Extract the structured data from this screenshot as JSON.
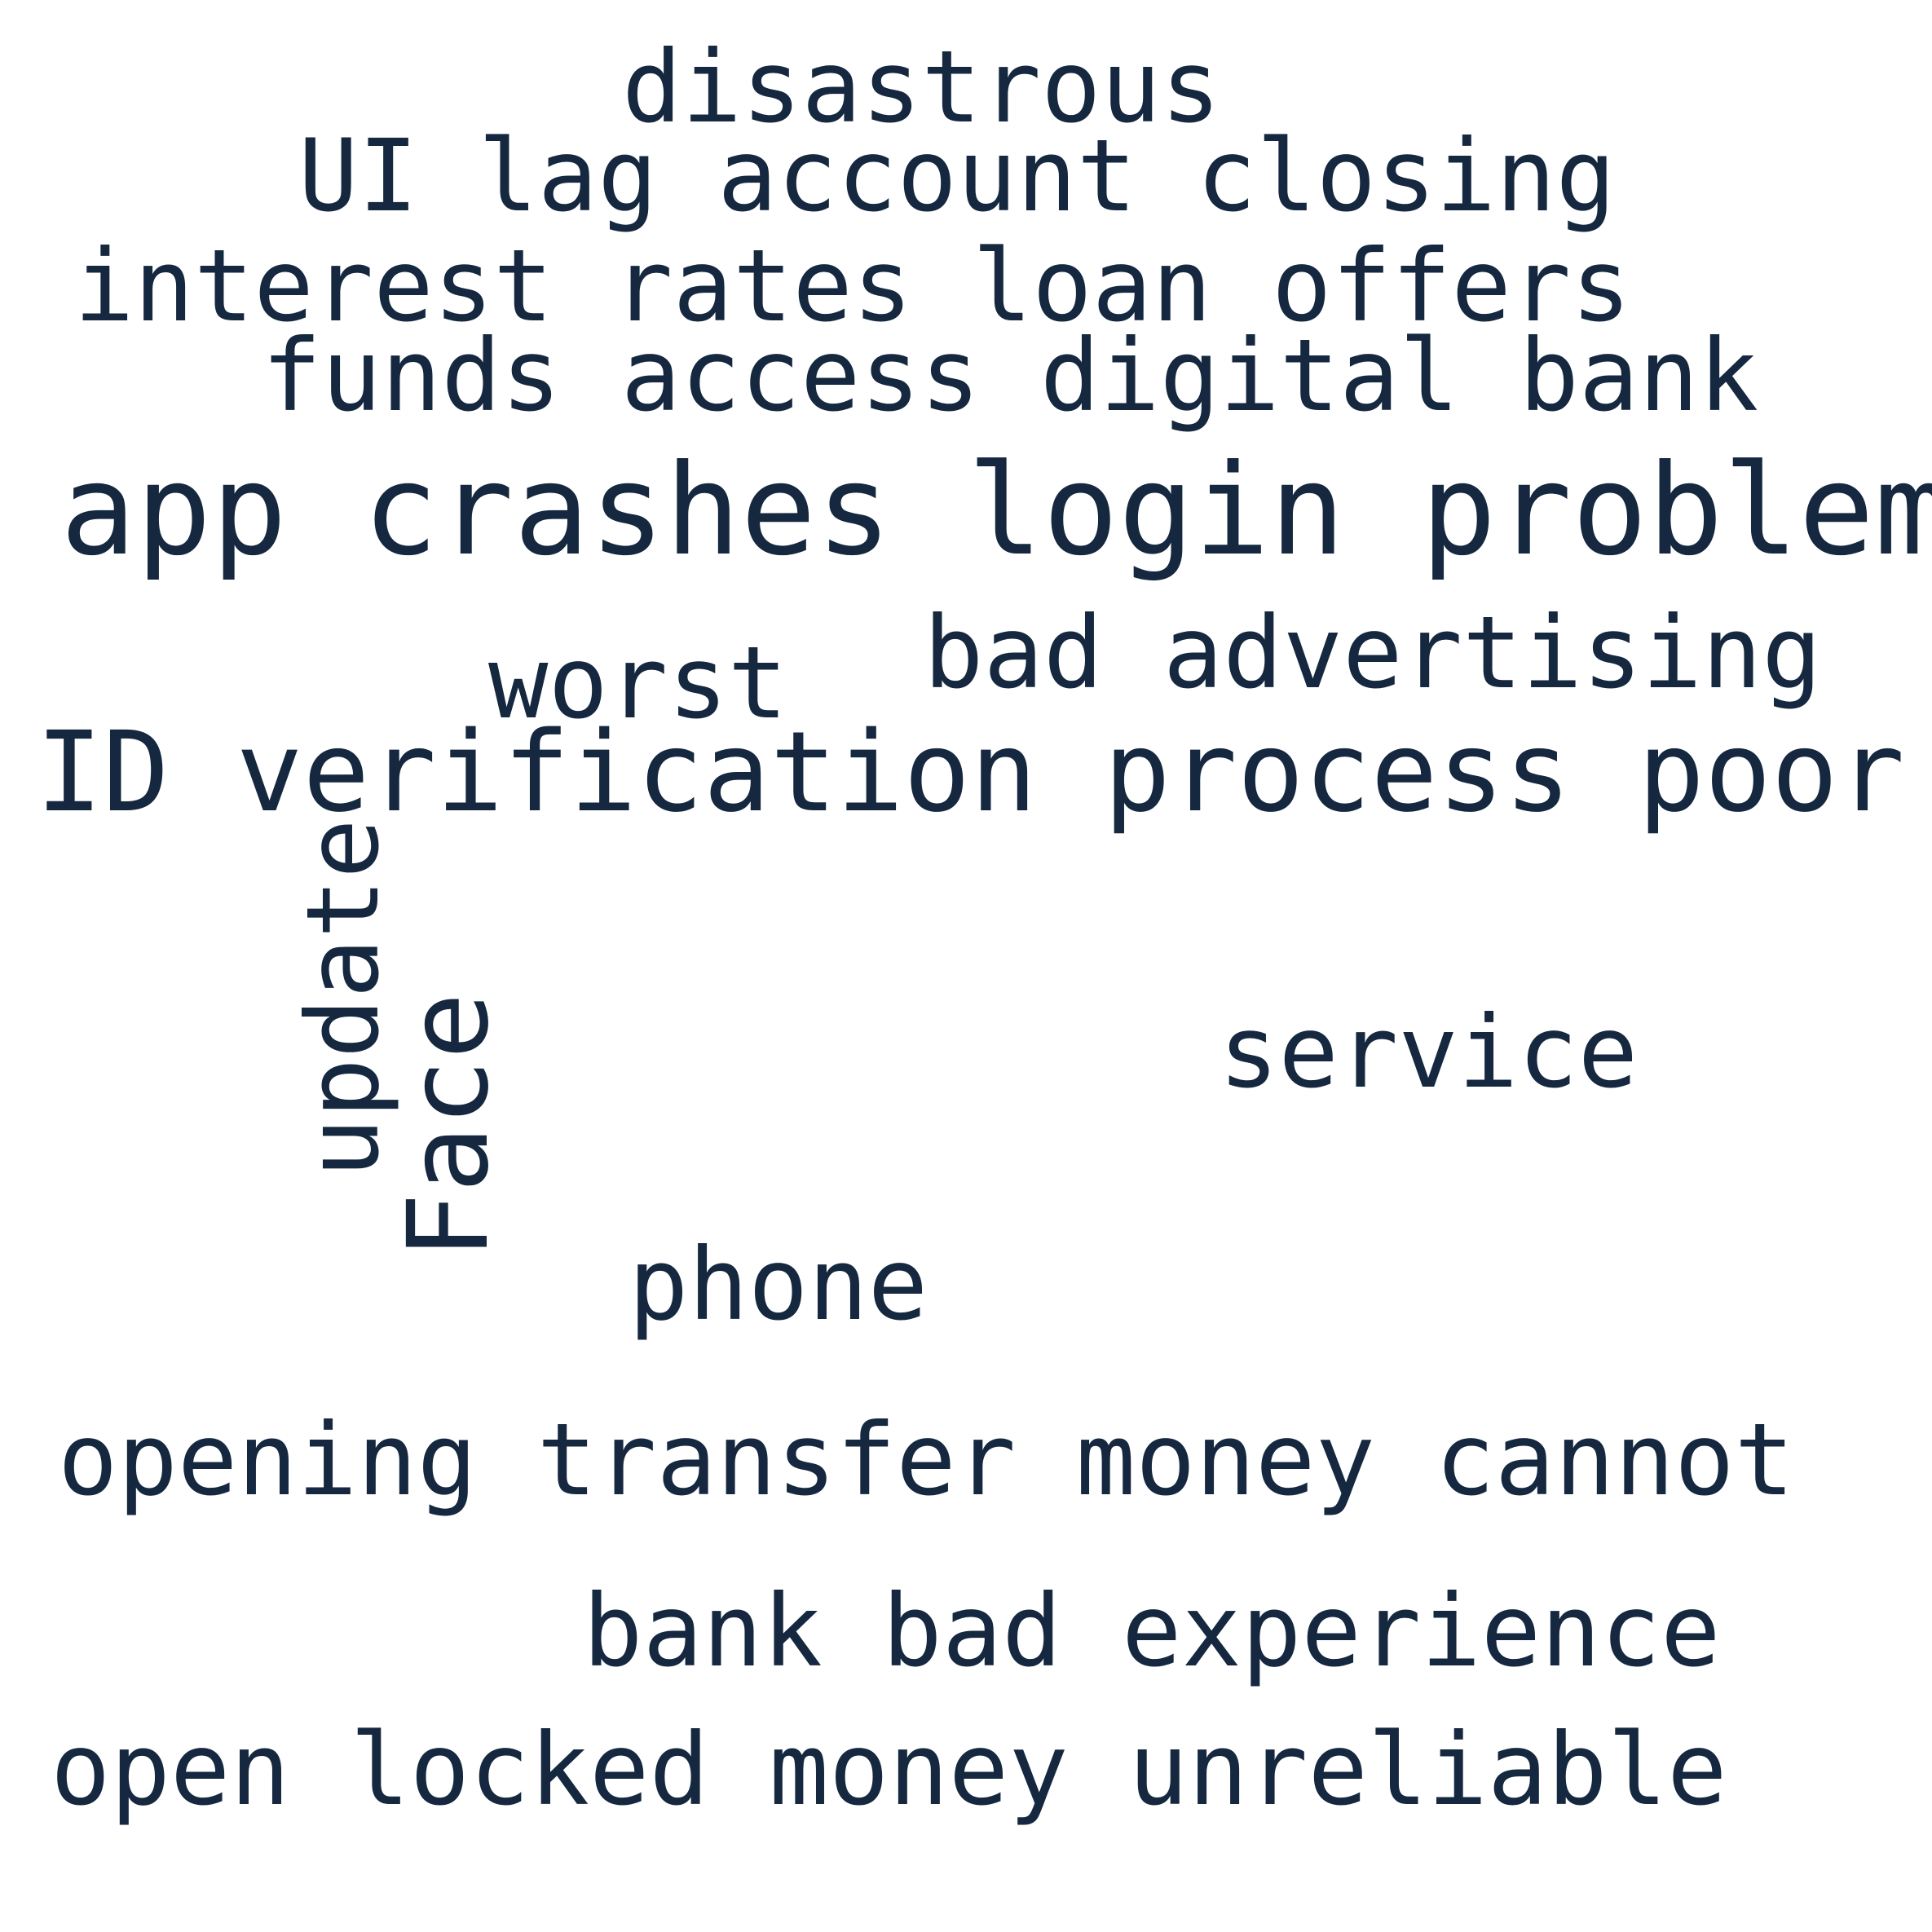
{
  "word_cloud": {
    "text_color": "#15283f",
    "background_color": "#ffffff",
    "words": [
      "disastrous",
      "UI lag account closing",
      "interest rates loan offers",
      "funds access digital bank",
      "app crashes login problems",
      "worst",
      "bad advertising",
      "ID verification process poor",
      "update",
      "Face",
      "service",
      "phone",
      "opening transfer money cannot",
      "bank bad experience",
      "open locked money unreliable"
    ]
  }
}
